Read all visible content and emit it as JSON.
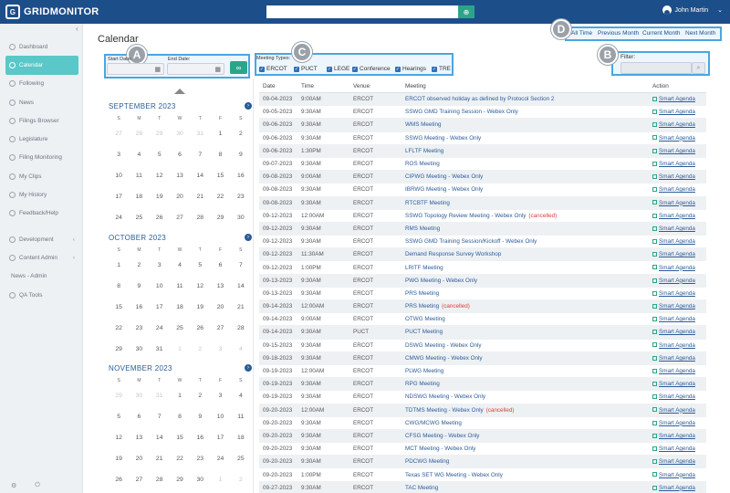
{
  "app": {
    "logo_text": "GRIDMONITOR",
    "logo_mark": "G"
  },
  "header": {
    "search_value": "",
    "user_name": "John Martin"
  },
  "sidebar": {
    "items": [
      {
        "label": "Dashboard",
        "icon": "dashboard-icon",
        "active": false
      },
      {
        "label": "Calendar",
        "icon": "calendar-icon",
        "active": true
      },
      {
        "label": "Following",
        "icon": "star-icon",
        "active": false
      },
      {
        "label": "News",
        "icon": "news-icon",
        "active": false
      },
      {
        "label": "Filings Browser",
        "icon": "folder-icon",
        "active": false
      },
      {
        "label": "Legislature",
        "icon": "gavel-icon",
        "active": false
      },
      {
        "label": "Filing Monitoring",
        "icon": "bell-icon",
        "active": false
      },
      {
        "label": "My Clips",
        "icon": "clip-icon",
        "active": false
      },
      {
        "label": "My History",
        "icon": "history-icon",
        "active": false
      },
      {
        "label": "Feedback/Help",
        "icon": "help-icon",
        "active": false
      },
      {
        "label": "Development",
        "icon": "code-icon",
        "active": false,
        "expand": true
      },
      {
        "label": "Content Admin",
        "icon": "admin-icon",
        "active": false,
        "expand": true
      },
      {
        "label": "News - Admin",
        "icon": "",
        "active": false
      },
      {
        "label": "QA Tools",
        "icon": "tools-icon",
        "active": false
      }
    ]
  },
  "page": {
    "title": "Calendar"
  },
  "callouts": {
    "a": "A",
    "b": "B",
    "c": "C",
    "d": "D"
  },
  "date_filter": {
    "start_label": "Start Date:",
    "end_label": "End Date:",
    "start_value": "",
    "end_value": "",
    "go": "GO"
  },
  "meeting_types": {
    "label": "Meeting Types:",
    "options": [
      {
        "label": "ERCOT",
        "checked": true
      },
      {
        "label": "PUCT",
        "checked": true
      },
      {
        "label": "LEGE",
        "checked": true
      },
      {
        "label": "Conference",
        "checked": true
      },
      {
        "label": "Hearings",
        "checked": true
      },
      {
        "label": "TRE",
        "checked": true
      }
    ]
  },
  "quick_ranges": [
    "All Time",
    "Previous Month",
    "Current Month",
    "Next Month"
  ],
  "filter": {
    "label": "Filter:",
    "value": ""
  },
  "calendar": {
    "dow": [
      "S",
      "M",
      "T",
      "W",
      "T",
      "F",
      "S"
    ],
    "months": [
      {
        "name": "SEPTEMBER 2023",
        "weeks": [
          [
            [
              "27",
              1
            ],
            [
              "28",
              1
            ],
            [
              "29",
              1
            ],
            [
              "30",
              1
            ],
            [
              "31",
              1
            ],
            [
              "1",
              0
            ],
            [
              "2",
              0
            ]
          ],
          [
            [
              "3",
              0
            ],
            [
              "4",
              0
            ],
            [
              "5",
              0
            ],
            [
              "6",
              0
            ],
            [
              "7",
              0
            ],
            [
              "8",
              0
            ],
            [
              "9",
              0
            ]
          ],
          [
            [
              "10",
              0
            ],
            [
              "11",
              0
            ],
            [
              "12",
              0
            ],
            [
              "13",
              0
            ],
            [
              "14",
              0
            ],
            [
              "15",
              0
            ],
            [
              "16",
              0
            ]
          ],
          [
            [
              "17",
              0
            ],
            [
              "18",
              0
            ],
            [
              "19",
              0
            ],
            [
              "20",
              0
            ],
            [
              "21",
              0
            ],
            [
              "22",
              0
            ],
            [
              "23",
              0
            ]
          ],
          [
            [
              "24",
              0
            ],
            [
              "25",
              0
            ],
            [
              "26",
              0
            ],
            [
              "27",
              0
            ],
            [
              "28",
              0
            ],
            [
              "29",
              0
            ],
            [
              "30",
              0
            ]
          ]
        ]
      },
      {
        "name": "OCTOBER 2023",
        "weeks": [
          [
            [
              "1",
              0
            ],
            [
              "2",
              0
            ],
            [
              "3",
              0
            ],
            [
              "4",
              0
            ],
            [
              "5",
              0
            ],
            [
              "6",
              0
            ],
            [
              "7",
              0
            ]
          ],
          [
            [
              "8",
              0
            ],
            [
              "9",
              0
            ],
            [
              "10",
              0
            ],
            [
              "11",
              0
            ],
            [
              "12",
              0
            ],
            [
              "13",
              0
            ],
            [
              "14",
              0
            ]
          ],
          [
            [
              "15",
              0
            ],
            [
              "16",
              0
            ],
            [
              "17",
              0
            ],
            [
              "18",
              0
            ],
            [
              "19",
              0
            ],
            [
              "20",
              0
            ],
            [
              "21",
              0
            ]
          ],
          [
            [
              "22",
              0
            ],
            [
              "23",
              0
            ],
            [
              "24",
              0
            ],
            [
              "25",
              0
            ],
            [
              "26",
              0
            ],
            [
              "27",
              0
            ],
            [
              "28",
              0
            ]
          ],
          [
            [
              "29",
              0
            ],
            [
              "30",
              0
            ],
            [
              "31",
              0
            ],
            [
              "1",
              1
            ],
            [
              "2",
              1
            ],
            [
              "3",
              1
            ],
            [
              "4",
              1
            ]
          ]
        ]
      },
      {
        "name": "NOVEMBER 2023",
        "weeks": [
          [
            [
              "29",
              1
            ],
            [
              "30",
              1
            ],
            [
              "31",
              1
            ],
            [
              "1",
              0
            ],
            [
              "2",
              0
            ],
            [
              "3",
              0
            ],
            [
              "4",
              0
            ]
          ],
          [
            [
              "5",
              0
            ],
            [
              "6",
              0
            ],
            [
              "7",
              0
            ],
            [
              "8",
              0
            ],
            [
              "9",
              0
            ],
            [
              "10",
              0
            ],
            [
              "11",
              0
            ]
          ],
          [
            [
              "12",
              0
            ],
            [
              "13",
              0
            ],
            [
              "14",
              0
            ],
            [
              "15",
              0
            ],
            [
              "16",
              0
            ],
            [
              "17",
              0
            ],
            [
              "18",
              0
            ]
          ],
          [
            [
              "19",
              0
            ],
            [
              "20",
              0
            ],
            [
              "21",
              0
            ],
            [
              "22",
              0
            ],
            [
              "23",
              0
            ],
            [
              "24",
              0
            ],
            [
              "25",
              0
            ]
          ],
          [
            [
              "26",
              0
            ],
            [
              "27",
              0
            ],
            [
              "28",
              0
            ],
            [
              "29",
              0
            ],
            [
              "30",
              0
            ],
            [
              "1",
              1
            ],
            [
              "2",
              1
            ]
          ]
        ]
      }
    ]
  },
  "table": {
    "headers": [
      "Date",
      "Time",
      "Venue",
      "Meeting",
      "Action"
    ],
    "action_label": "Smart Agenda",
    "cancelled_label": "(cancelled)",
    "rows": [
      [
        "09-04-2023",
        "9:00AM",
        "ERCOT",
        "ERCOT observed holiday as defined by Protocol Section 2",
        false
      ],
      [
        "09-05-2023",
        "9:30AM",
        "ERCOT",
        "SSWG GMD Training Session - Webex Only",
        false
      ],
      [
        "09-06-2023",
        "9:30AM",
        "ERCOT",
        "WMS Meeting",
        false
      ],
      [
        "09-06-2023",
        "9:30AM",
        "ERCOT",
        "SSWG Meeting - Webex Only",
        false
      ],
      [
        "09-06-2023",
        "1:30PM",
        "ERCOT",
        "LFLTF Meeting",
        false
      ],
      [
        "09-07-2023",
        "9:30AM",
        "ERCOT",
        "ROS Meeting",
        false
      ],
      [
        "09-08-2023",
        "9:00AM",
        "ERCOT",
        "CIPWG Meeting - Webex Only",
        false
      ],
      [
        "09-08-2023",
        "9:30AM",
        "ERCOT",
        "IBRWG Meeting - Webex Only",
        false
      ],
      [
        "09-08-2023",
        "9:30AM",
        "ERCOT",
        "RTCBTF Meeting",
        false
      ],
      [
        "09-12-2023",
        "12:00AM",
        "ERCOT",
        "SSWG Topology Review Meeting - Webex Only",
        true
      ],
      [
        "09-12-2023",
        "9:30AM",
        "ERCOT",
        "RMS Meeting",
        false
      ],
      [
        "09-12-2023",
        "9:30AM",
        "ERCOT",
        "SSWG GMD Training Session/Kickoff - Webex Only",
        false
      ],
      [
        "09-12-2023",
        "11:30AM",
        "ERCOT",
        "Demand Response Survey Workshop",
        false
      ],
      [
        "09-12-2023",
        "1:00PM",
        "ERCOT",
        "LRITF Meeting",
        false
      ],
      [
        "09-13-2023",
        "9:30AM",
        "ERCOT",
        "PWG Meeting - Webex Only",
        false
      ],
      [
        "09-13-2023",
        "9:30AM",
        "ERCOT",
        "PRS Meeting",
        false
      ],
      [
        "09-14-2023",
        "12:00AM",
        "ERCOT",
        "PRS Meeting",
        true
      ],
      [
        "09-14-2023",
        "9:00AM",
        "ERCOT",
        "OTWG Meeting",
        false
      ],
      [
        "09-14-2023",
        "9:30AM",
        "PUCT",
        "PUCT Meeting",
        false
      ],
      [
        "09-15-2023",
        "9:30AM",
        "ERCOT",
        "DSWG Meeting - Webex Only",
        false
      ],
      [
        "09-18-2023",
        "9:30AM",
        "ERCOT",
        "CMWG Meeting - Webex Only",
        false
      ],
      [
        "09-19-2023",
        "12:00AM",
        "ERCOT",
        "PLWG Meeting",
        false
      ],
      [
        "09-19-2023",
        "9:30AM",
        "ERCOT",
        "RPG Meeting",
        false
      ],
      [
        "09-19-2023",
        "9:30AM",
        "ERCOT",
        "NDSWG Meeting - Webex Only",
        false
      ],
      [
        "09-20-2023",
        "12:00AM",
        "ERCOT",
        "TDTMS Meeting - Webex Only",
        true
      ],
      [
        "09-20-2023",
        "9:30AM",
        "ERCOT",
        "CWG/MCWG Meeting",
        false
      ],
      [
        "09-20-2023",
        "9:30AM",
        "ERCOT",
        "CFSG Meeting - Webex Only",
        false
      ],
      [
        "09-20-2023",
        "9:30AM",
        "ERCOT",
        "MCT Meeting - Webex Only",
        false
      ],
      [
        "09-20-2023",
        "9:30AM",
        "ERCOT",
        "PDCWG Meeting",
        false
      ],
      [
        "09-20-2023",
        "1:00PM",
        "ERCOT",
        "Texas SET WG Meeting - Webex Only",
        false
      ],
      [
        "09-27-2023",
        "9:30AM",
        "ERCOT",
        "TAC Meeting",
        false
      ]
    ]
  },
  "colors": {
    "header": "#1c4e8a",
    "accent": "#2ba58a",
    "active_nav": "#5ac8c8",
    "callout": "#4aa6e0",
    "cancelled": "#d9413a",
    "link": "#2b5c98"
  }
}
